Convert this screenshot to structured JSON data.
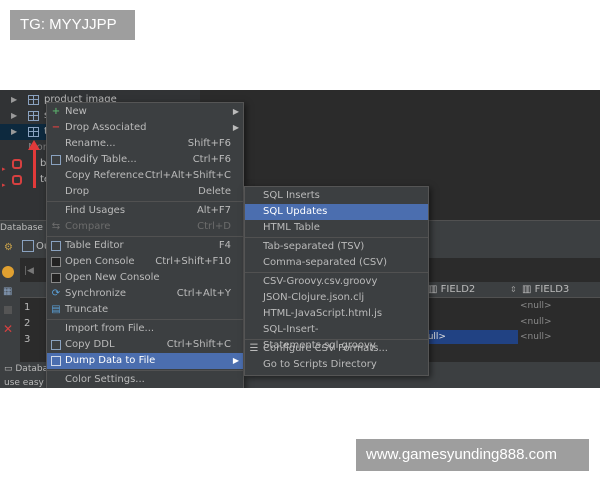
{
  "watermarks": {
    "top_left": "TG: MYYJJPP",
    "bottom_right": "www.gamesyunding888.com"
  },
  "tree": {
    "items": [
      {
        "label": "product image"
      },
      {
        "label": "s"
      },
      {
        "label": "t"
      }
    ],
    "partial_labels": {
      "more": "Mor",
      "b": "b",
      "te": "te"
    }
  },
  "db_panel": {
    "title": "Database C",
    "tab_label": "Ou"
  },
  "grid": {
    "columns": [
      "FIELD2",
      "FIELD3"
    ],
    "null_value": "<null>",
    "selected_value": "null>",
    "row_numbers": [
      "1",
      "2",
      "3"
    ]
  },
  "bottom": {
    "tab": "Databa",
    "status": "use easy"
  },
  "context_menu": {
    "items": [
      {
        "icon": "plus-icon",
        "label": "New",
        "shortcut": "",
        "submenu": true
      },
      {
        "icon": "minus-icon",
        "label": "Drop Associated",
        "shortcut": "",
        "submenu": true
      },
      {
        "icon": "",
        "label": "Rename...",
        "shortcut": "Shift+F6"
      },
      {
        "icon": "table-icon",
        "label": "Modify Table...",
        "shortcut": "Ctrl+F6"
      },
      {
        "icon": "",
        "label": "Copy Reference",
        "shortcut": "Ctrl+Alt+Shift+C"
      },
      {
        "icon": "",
        "label": "Drop",
        "shortcut": "Delete"
      },
      {
        "icon": "",
        "label": "Find Usages",
        "shortcut": "Alt+F7"
      },
      {
        "icon": "compare-icon",
        "label": "Compare",
        "shortcut": "Ctrl+D",
        "disabled": true
      },
      {
        "icon": "table-editor-icon",
        "label": "Table Editor",
        "shortcut": "F4"
      },
      {
        "icon": "console-icon",
        "label": "Open Console",
        "shortcut": "Ctrl+Shift+F10"
      },
      {
        "icon": "new-console-icon",
        "label": "Open New Console",
        "shortcut": ""
      },
      {
        "icon": "sync-icon",
        "label": "Synchronize",
        "shortcut": "Ctrl+Alt+Y"
      },
      {
        "icon": "truncate-icon",
        "label": "Truncate",
        "shortcut": ""
      },
      {
        "icon": "",
        "label": "Import from File...",
        "shortcut": ""
      },
      {
        "icon": "copy-ddl-icon",
        "label": "Copy DDL",
        "shortcut": "Ctrl+Shift+C"
      },
      {
        "icon": "dump-icon",
        "label": "Dump Data to File",
        "shortcut": "",
        "submenu": true,
        "highlighted": true
      },
      {
        "icon": "",
        "label": "Color Settings...",
        "shortcut": ""
      }
    ]
  },
  "submenu": {
    "items": [
      {
        "label": "SQL Inserts"
      },
      {
        "label": "SQL Updates",
        "highlighted": true
      },
      {
        "label": "HTML Table"
      },
      {
        "label": "Tab-separated (TSV)"
      },
      {
        "label": "Comma-separated (CSV)"
      },
      {
        "label": "CSV-Groovy.csv.groovy"
      },
      {
        "label": "JSON-Clojure.json.clj"
      },
      {
        "label": "HTML-JavaScript.html.js"
      },
      {
        "label": "SQL-Insert-Statements.sql.groovy"
      },
      {
        "label": "Configure CSV Formats...",
        "icon": "configure-icon"
      },
      {
        "label": "Go to Scripts Directory"
      }
    ]
  },
  "colors": {
    "ide_bg": "#2b2b2b",
    "menu_bg": "#3c3f41",
    "highlight": "#4b6eaf",
    "arrow": "#e23a3a"
  }
}
